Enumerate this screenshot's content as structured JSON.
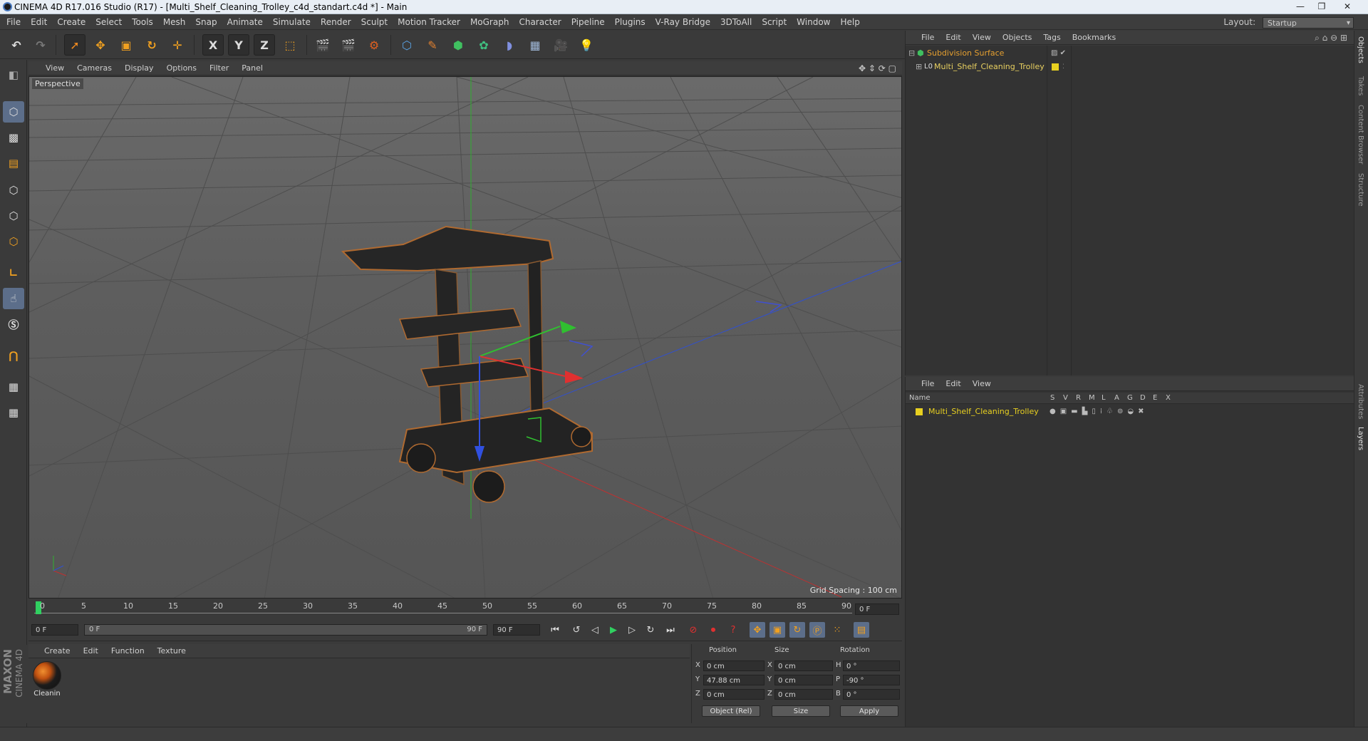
{
  "window": {
    "title": "CINEMA 4D R17.016 Studio (R17) - [Multi_Shelf_Cleaning_Trolley_c4d_standart.c4d *] - Main",
    "controls": [
      "—",
      "❐",
      "✕"
    ]
  },
  "menubar": {
    "items": [
      "File",
      "Edit",
      "Create",
      "Select",
      "Tools",
      "Mesh",
      "Snap",
      "Animate",
      "Simulate",
      "Render",
      "Sculpt",
      "Motion Tracker",
      "MoGraph",
      "Character",
      "Pipeline",
      "Plugins",
      "V-Ray Bridge",
      "3DToAll",
      "Script",
      "Window",
      "Help"
    ],
    "layout_label": "Layout:",
    "layout_value": "Startup"
  },
  "toolbar": {
    "axis": [
      "X",
      "Y",
      "Z"
    ]
  },
  "viewport": {
    "menu": [
      "View",
      "Cameras",
      "Display",
      "Options",
      "Filter",
      "Panel"
    ],
    "label": "Perspective",
    "grid_spacing": "Grid Spacing : 100 cm"
  },
  "timeline": {
    "ticks": [
      "0",
      "5",
      "10",
      "15",
      "20",
      "25",
      "30",
      "35",
      "40",
      "45",
      "50",
      "55",
      "60",
      "65",
      "70",
      "75",
      "80",
      "85",
      "90"
    ],
    "current_frame": "0 F",
    "start_field": "0 F",
    "range_start": "0 F",
    "range_end": "90 F",
    "end_field": "90 F"
  },
  "materials": {
    "menu": [
      "Create",
      "Edit",
      "Function",
      "Texture"
    ],
    "items": [
      {
        "name": "Cleanin"
      }
    ]
  },
  "brand": {
    "line1": "MAXON",
    "line2": "CINEMA 4D"
  },
  "coords": {
    "headers": [
      "Position",
      "Size",
      "Rotation"
    ],
    "rows": [
      {
        "axis": "X",
        "pos": "0 cm",
        "saxis": "X",
        "size": "0 cm",
        "raxis": "H",
        "rot": "0 °"
      },
      {
        "axis": "Y",
        "pos": "47.88 cm",
        "saxis": "Y",
        "size": "0 cm",
        "raxis": "P",
        "rot": "-90 °"
      },
      {
        "axis": "Z",
        "pos": "0 cm",
        "saxis": "Z",
        "size": "0 cm",
        "raxis": "B",
        "rot": "0 °"
      }
    ],
    "mode": "Object (Rel)",
    "size_mode": "Size",
    "apply": "Apply"
  },
  "objects": {
    "menu": [
      "File",
      "Edit",
      "View",
      "Objects",
      "Tags",
      "Bookmarks"
    ],
    "items": [
      {
        "name": "Subdivision Surface",
        "color": "#e6a030"
      },
      {
        "name": "Multi_Shelf_Cleaning_Trolley",
        "color": "#e8d060"
      }
    ]
  },
  "layers": {
    "menu": [
      "File",
      "Edit",
      "View"
    ],
    "name_header": "Name",
    "columns": [
      "S",
      "V",
      "R",
      "M",
      "L",
      "A",
      "G",
      "D",
      "E",
      "X"
    ],
    "items": [
      {
        "name": "Multi_Shelf_Cleaning_Trolley",
        "color": "#e8d020"
      }
    ]
  },
  "sidetabs": [
    "Objects",
    "Takes",
    "Content Browser",
    "Structure",
    "Attributes",
    "Layers"
  ],
  "colors": {
    "accent": "#5c6e8a",
    "orange": "#e6a030",
    "x_axis": "#e03030",
    "y_axis": "#30c030",
    "z_axis": "#3050e0"
  }
}
